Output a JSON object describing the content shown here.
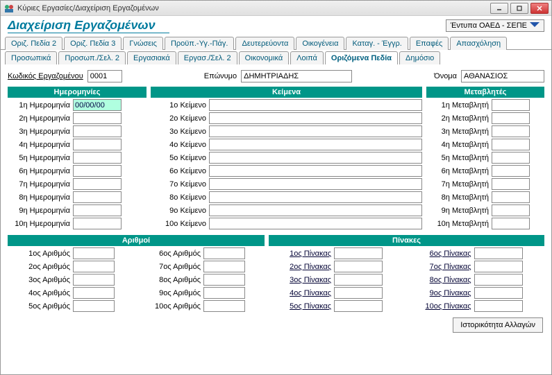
{
  "window": {
    "title": "Κύριες Εργασίες/Διαχείριση Εργαζομένων",
    "minimize": "–",
    "maximize": "□",
    "close": "✕"
  },
  "header": {
    "title": "Διαχείριση Εργαζομένων",
    "dropdown": "Έντυπα ΟΑΕΔ - ΣΕΠΕ"
  },
  "tabs_row1": [
    "Οριζ. Πεδία 2",
    "Οριζ. Πεδία 3",
    "Γνώσεις",
    "Προϋπ.-Υγ.-Πάγ.",
    "Δευτερεύοντα",
    "Οικογένεια",
    "Καταγ. - Έγγρ.",
    "Επαφές",
    "Απασχόληση"
  ],
  "tabs_row2": [
    "Προσωπικά",
    "Προσωπ./Σελ. 2",
    "Εργασιακά",
    "Εργασ./Σελ. 2",
    "Οικονομικά",
    "Λοιπά",
    "Οριζόμενα Πεδία",
    "Δημόσιο"
  ],
  "active_tab": "Οριζόμενα Πεδία",
  "id_row": {
    "code_label": "Κωδικός Εργαζομένου",
    "code_value": "0001",
    "surname_label": "Επώνυμο",
    "surname_value": "ΔΗΜΗΤΡΙΑΔΗΣ",
    "name_label": "Όνομα",
    "name_value": "ΑΘΑΝΑΣΙΟΣ"
  },
  "sections": {
    "dates": {
      "title": "Ημερομηνίες",
      "labels": [
        "1η Ημερομηνία",
        "2η Ημερομηνία",
        "3η Ημερομηνία",
        "4η Ημερομηνία",
        "5η Ημερομηνία",
        "6η Ημερομηνία",
        "7η Ημερομηνία",
        "8η Ημερομηνία",
        "9η Ημερομηνία",
        "10η Ημερομηνία"
      ],
      "first_value": "00/00/00"
    },
    "texts": {
      "title": "Κείμενα",
      "labels": [
        "1ο Κείμενο",
        "2ο Κείμενο",
        "3ο Κείμενο",
        "4ο Κείμενο",
        "5ο Κείμενο",
        "6ο Κείμενο",
        "7ο Κείμενο",
        "8ο Κείμενο",
        "9ο Κείμενο",
        "10ο Κείμενο"
      ]
    },
    "vars": {
      "title": "Μεταβλητές",
      "labels": [
        "1η Μεταβλητή",
        "2η Μεταβλητή",
        "3η Μεταβλητή",
        "4η Μεταβλητή",
        "5η Μεταβλητή",
        "6η Μεταβλητή",
        "7η Μεταβλητή",
        "8η Μεταβλητή",
        "9η Μεταβλητή",
        "10η Μεταβλητή"
      ]
    },
    "numbers": {
      "title": "Αριθμοί",
      "left": [
        "1ος Αριθμός",
        "2ος Αριθμός",
        "3ος Αριθμός",
        "4ος Αριθμός",
        "5ος Αριθμός"
      ],
      "right": [
        "6ος Αριθμός",
        "7ος Αριθμός",
        "8ος Αριθμός",
        "9ος Αριθμός",
        "10ος Αριθμός"
      ]
    },
    "tables": {
      "title": "Πίνακες",
      "left": [
        "1ος Πίνακας",
        "2ος Πίνακας",
        "3ος Πίνακας",
        "4ος Πίνακας",
        "5ος Πίνακας"
      ],
      "right": [
        "6ος Πίνακας",
        "7ος Πίνακας",
        "8ος Πίνακας",
        "9ος Πίνακας",
        "10ος Πίνακας"
      ]
    }
  },
  "bottom_button": "Ιστορικότητα Αλλαγών"
}
